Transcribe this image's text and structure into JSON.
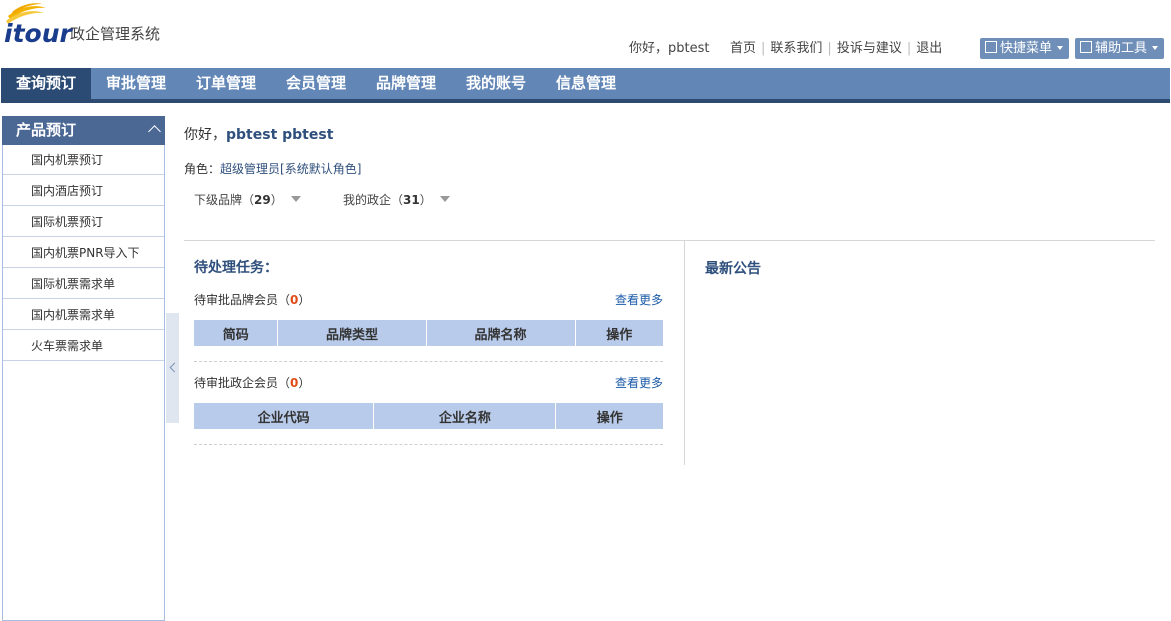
{
  "header": {
    "logo_text": "itour",
    "system_name": "政企管理系统",
    "greeting": "你好，pbtest",
    "links": [
      "首页",
      "联系我们",
      "投诉与建议",
      "退出"
    ],
    "quick_menu": "快捷菜单",
    "aux_tools": "辅助工具"
  },
  "nav": {
    "items": [
      "查询预订",
      "审批管理",
      "订单管理",
      "会员管理",
      "品牌管理",
      "我的账号",
      "信息管理"
    ],
    "active": "查询预订"
  },
  "sidebar": {
    "title": "产品预订",
    "items": [
      "国内机票预订",
      "国内酒店预订",
      "国际机票预订",
      "国内机票PNR导入下",
      "国际机票需求单",
      "国内机票需求单",
      "火车票需求单"
    ]
  },
  "main": {
    "hello_prefix": "你好，",
    "user_name": "pbtest pbtest",
    "role_label": "角色：",
    "role_value": "超级管理员[系统默认角色]",
    "sub_brand_label": "下级品牌（",
    "sub_brand_count": "29",
    "sub_brand_suffix": "）",
    "my_corp_label": "我的政企（",
    "my_corp_count": "31",
    "my_corp_suffix": "）",
    "tasks_title": "待处理任务：",
    "brand_members": {
      "label": "待审批品牌会员（",
      "count": "0",
      "suffix": "）",
      "more": "查看更多",
      "columns": [
        "简码",
        "品牌类型",
        "品牌名称",
        "操作"
      ]
    },
    "corp_members": {
      "label": "待审批政企会员（",
      "count": "0",
      "suffix": "）",
      "more": "查看更多",
      "columns": [
        "企业代码",
        "企业名称",
        "操作"
      ]
    },
    "notice_title": "最新公告"
  },
  "colors": {
    "nav_bg": "#6286b6",
    "nav_active": "#2b4b74",
    "accent": "#2f4f7c",
    "count_red": "#e14b16",
    "table_head": "#b9cbea"
  }
}
